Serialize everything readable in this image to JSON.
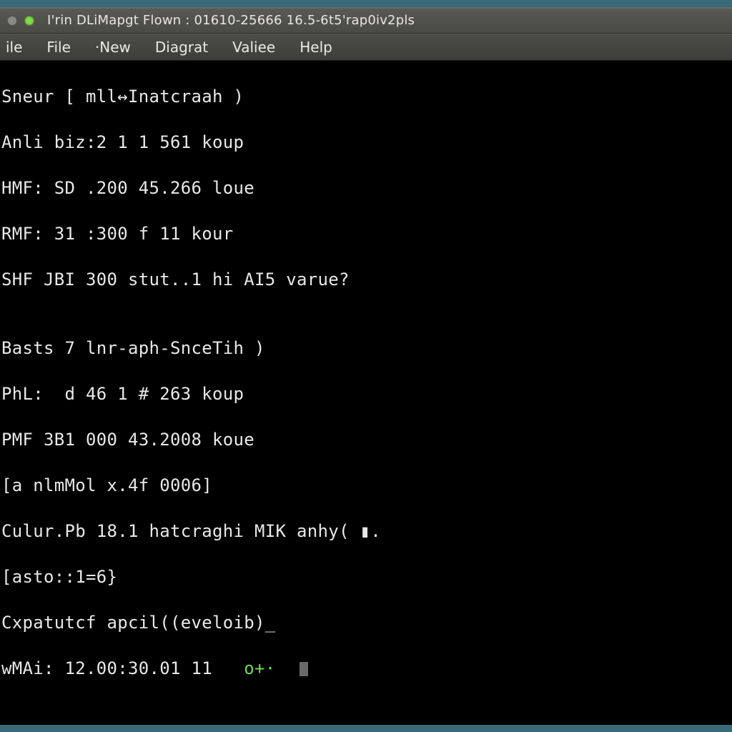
{
  "titlebar": {
    "title": "I'rin DLiMapgt Flown : 01610-25666 16.5-6t5'raр0iv2pls"
  },
  "menu": {
    "items": [
      "ile",
      "File",
      "·New",
      "Diagrat",
      "Valiee",
      "Help"
    ]
  },
  "terminal": {
    "lines": [
      "Sneur [ mll↔Inatcraah )",
      "Anli biz:2 1 1 561 koup",
      "HMF: SD .200 45.266 loue",
      "RMF: 31 :300 f 11 kour",
      "SHF JBI 300 stut..1 hi AI5 varue?",
      "",
      "Basts 7 lnr-aph-SnceTih )",
      "PhL:  d 46 1 # 263 koup",
      "PMF 3B1 000 43.2008 koue",
      "[a nlmMol x.4f 0006]",
      "Culur.Pb 18.1 hatcraghi MIK anhy( ▮.",
      "[asto::1=6}",
      "Cxpatutcf apcil((eveloib)_"
    ],
    "last_line_prefix": "wMAi: 12.00:30.01 11   ",
    "last_line_accent": "o+·"
  }
}
